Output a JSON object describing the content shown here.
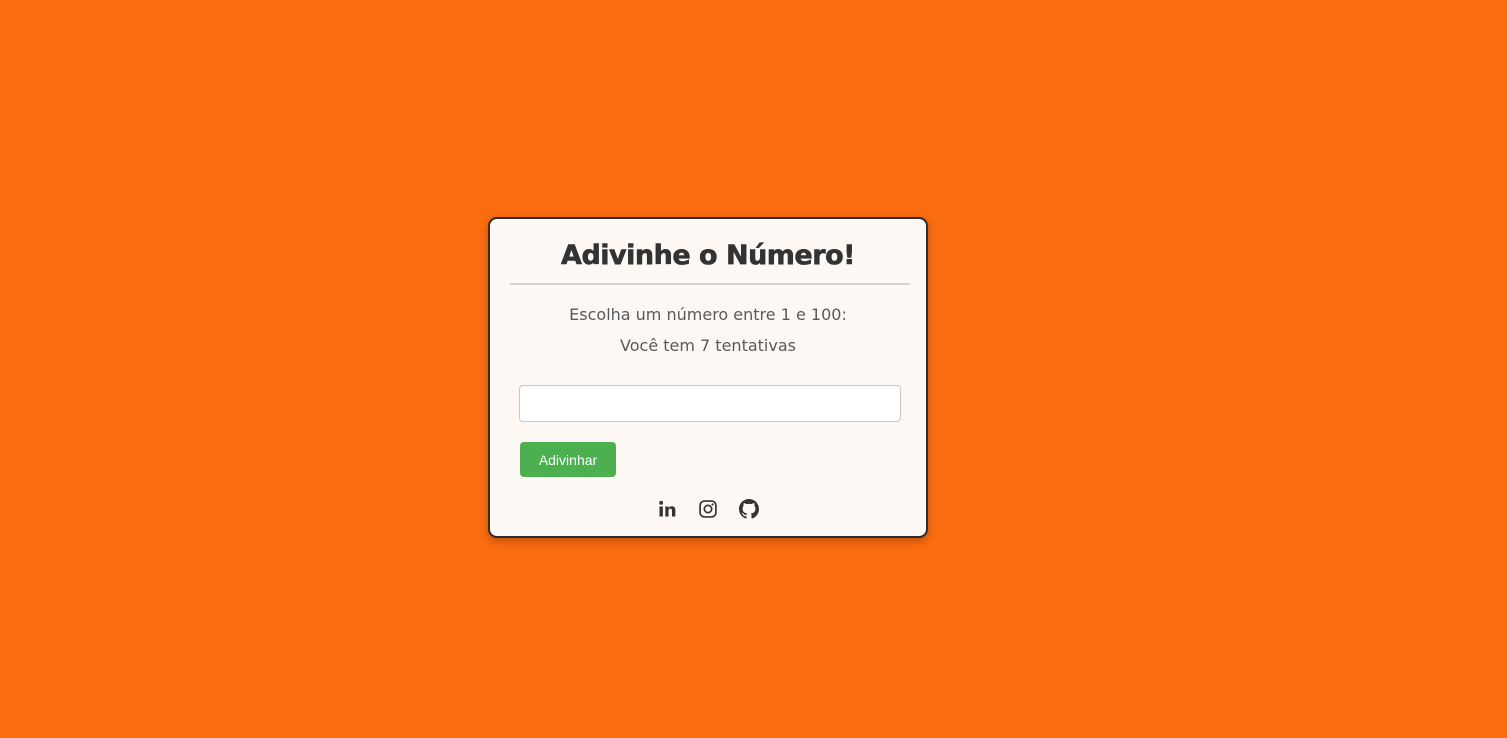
{
  "card": {
    "title": "Adivinhe o Número!",
    "instruction": "Escolha um número entre 1 e 100:",
    "attempts_text": "Você tem 7 tentativas"
  },
  "guess": {
    "input_value": "",
    "button_label": "Adivinhar"
  },
  "social_links": [
    {
      "icon": "linkedin-icon"
    },
    {
      "icon": "instagram-icon"
    },
    {
      "icon": "github-icon"
    }
  ],
  "colors": {
    "background": "#fa6c10",
    "card_background": "#fdf8f3",
    "button": "#4caf50",
    "text_dark": "#333333",
    "text_muted": "#5a5a5a"
  }
}
